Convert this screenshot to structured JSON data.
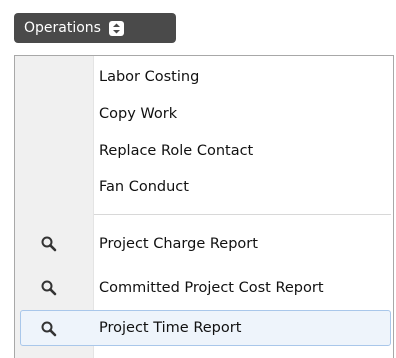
{
  "button": {
    "label": "Operations",
    "toggle_icon": "up-down-chevron-icon"
  },
  "menu": {
    "group1": [
      {
        "label": "Labor Costing"
      },
      {
        "label": "Copy Work"
      },
      {
        "label": "Replace Role Contact"
      },
      {
        "label": "Fan Conduct"
      }
    ],
    "group2": [
      {
        "label": "Project Charge Report",
        "icon": "search-icon"
      },
      {
        "label": "Committed Project Cost Report",
        "icon": "search-icon"
      },
      {
        "label": "Project Time Report",
        "icon": "search-icon",
        "highlighted": true
      }
    ]
  },
  "colors": {
    "button_bg": "#4a4a4a",
    "gutter_bg": "#f0f0f0",
    "highlight_bg": "#eef4fb",
    "highlight_border": "#a9c7ea"
  }
}
